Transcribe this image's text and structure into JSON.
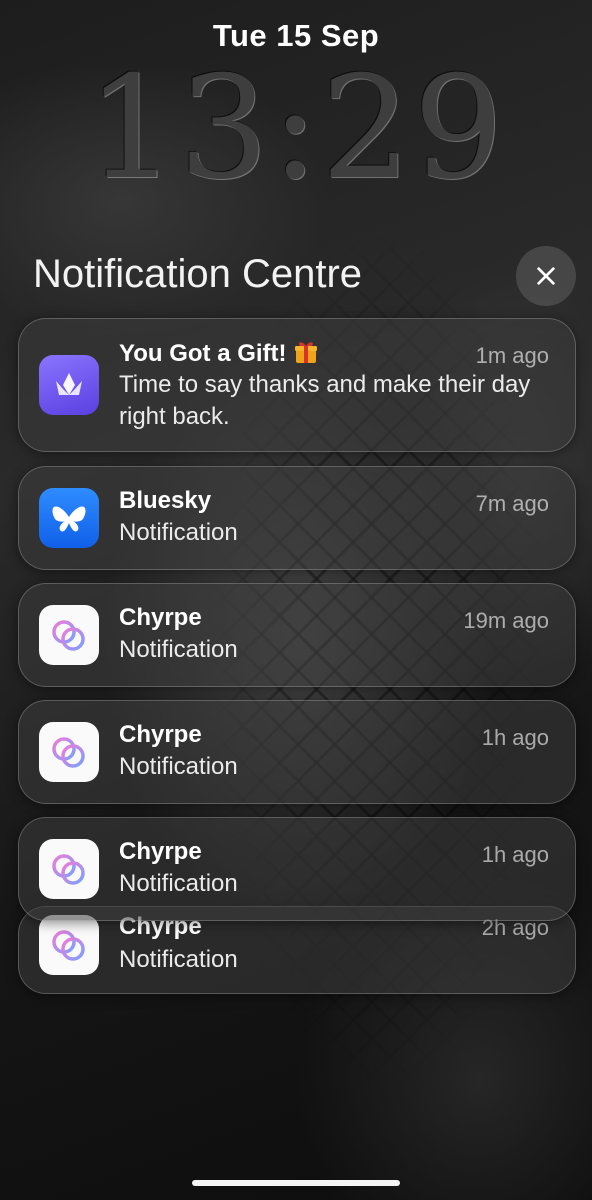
{
  "lock_screen": {
    "date": "Tue 15 Sep",
    "time": "13:29"
  },
  "notification_centre": {
    "title": "Notification Centre",
    "close_icon": "close-icon"
  },
  "notifications": [
    {
      "app_icon": "crown-icon",
      "title": "You Got a Gift!",
      "title_emoji": "gift-icon",
      "time": "1m ago",
      "body": "Time to say thanks and make their day right back."
    },
    {
      "app_icon": "butterfly-icon",
      "title": "Bluesky",
      "time": "7m ago",
      "body": "Notification"
    },
    {
      "app_icon": "rings-icon",
      "title": "Chyrpe",
      "time": "19m ago",
      "body": "Notification"
    },
    {
      "app_icon": "rings-icon",
      "title": "Chyrpe",
      "time": "1h ago",
      "body": "Notification"
    },
    {
      "app_icon": "rings-icon",
      "title": "Chyrpe",
      "time": "1h ago",
      "body": "Notification"
    },
    {
      "app_icon": "rings-icon",
      "title": "Chyrpe",
      "time": "2h ago",
      "body": "Notification"
    }
  ],
  "colors": {
    "gift_app": "#6c52f0",
    "bluesky_app": "#1a74f5",
    "chyrpe_app": "#fafafa"
  }
}
